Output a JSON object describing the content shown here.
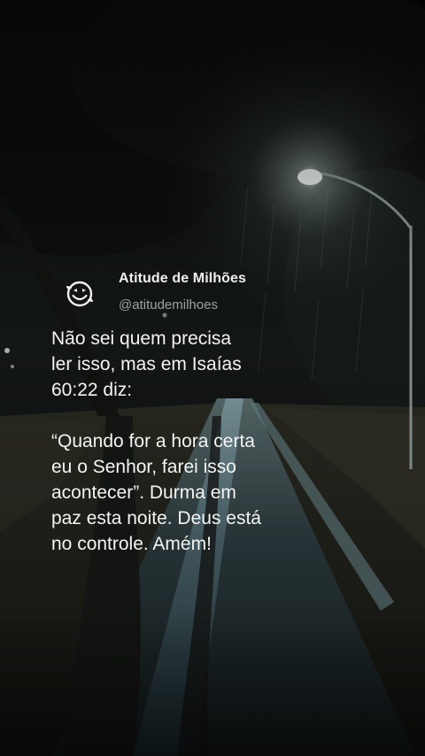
{
  "post": {
    "author_name": "Atitude de Milhões",
    "author_handle": "@atitudemilhoes",
    "avatar_icon": "smiley-face-icon",
    "paragraph_1": "Não sei quem precisa\nler isso, mas em Isaías\n60:22 diz:",
    "paragraph_2": "“Quando for a hora certa\neu o Senhor, farei isso\nacontecer”. Durma em\npaz esta noite. Deus está\nno controle. Amém!"
  },
  "colors": {
    "background": "#0b0d0c",
    "text": "#f3f5f3",
    "handle": "#9aa3a0"
  }
}
